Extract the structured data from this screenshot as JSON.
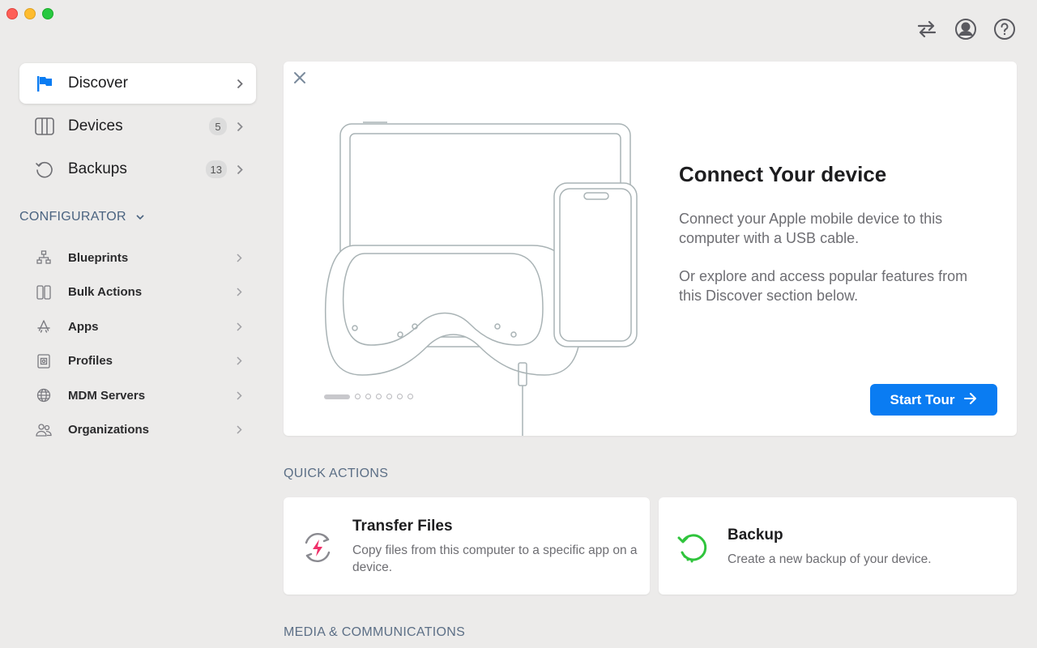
{
  "window": {
    "controls": [
      "close",
      "minimize",
      "zoom"
    ]
  },
  "toolbar": {
    "icons": [
      "transfer-arrows-icon",
      "account-icon",
      "help-icon"
    ]
  },
  "sidebar": {
    "items": [
      {
        "label": "Discover",
        "icon": "flag-icon",
        "badge": null,
        "active": true
      },
      {
        "label": "Devices",
        "icon": "devices-icon",
        "badge": "5",
        "active": false
      },
      {
        "label": "Backups",
        "icon": "backup-icon",
        "badge": "13",
        "active": false
      }
    ],
    "configurator": {
      "title": "CONFIGURATOR",
      "items": [
        {
          "label": "Blueprints",
          "icon": "blueprints-icon"
        },
        {
          "label": "Bulk Actions",
          "icon": "bulk-actions-icon"
        },
        {
          "label": "Apps",
          "icon": "apps-icon"
        },
        {
          "label": "Profiles",
          "icon": "profiles-icon"
        },
        {
          "label": "MDM Servers",
          "icon": "globe-icon"
        },
        {
          "label": "Organizations",
          "icon": "organizations-icon"
        }
      ]
    }
  },
  "hero": {
    "title": "Connect Your device",
    "desc1": "Connect your Apple mobile device to this computer with a USB cable.",
    "desc2": "Or explore and access popular features from this Discover section below.",
    "pager": {
      "total": 7,
      "current": 1
    },
    "button": "Start Tour"
  },
  "quick_actions": {
    "title": "QUICK ACTIONS",
    "cards": [
      {
        "title": "Transfer Files",
        "desc": "Copy files from this computer to a specific app on a device.",
        "icon": "transfer-files-icon"
      },
      {
        "title": "Backup",
        "desc": "Create a new backup of your device.",
        "icon": "backup-refresh-icon"
      }
    ]
  },
  "media": {
    "title": "MEDIA & COMMUNICATIONS"
  },
  "colors": {
    "accent": "#0a7cf2",
    "backup_green": "#2fc43c",
    "transfer_red": "#f0306a"
  }
}
